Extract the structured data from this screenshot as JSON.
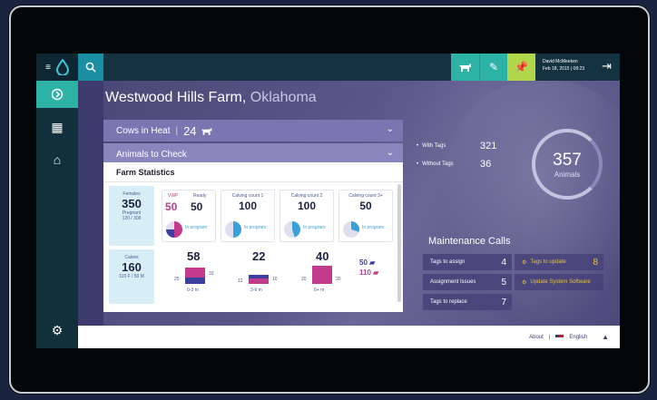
{
  "header": {
    "user_name": "David McMeeken",
    "user_date": "Feb 18, 2015 | 08:23",
    "actions": [
      "cow-icon",
      "pencil-icon",
      "pin-icon"
    ],
    "colors": {
      "cow": "#2cb3a6",
      "pencil": "#2cb3a6",
      "pin": "#b2d64a"
    }
  },
  "farm": {
    "name": "Westwood Hills Farm,",
    "state": "Oklahoma"
  },
  "dropdowns": {
    "cows_in_heat": "Cows in Heat",
    "cows_in_heat_count": "24",
    "animals_to_check": "Animals to Check"
  },
  "stats": {
    "title": "Farm Statistics",
    "females": {
      "label": "Females",
      "value": "350",
      "sub": "Pregnant",
      "sub_value": "120 / 300"
    },
    "cards": [
      {
        "label1": "VWP",
        "v1": "50",
        "label2": "Ready",
        "v2": "50",
        "note": "In program"
      },
      {
        "label": "Calving count 1",
        "value": "100",
        "note": "In program"
      },
      {
        "label": "Calving count 2",
        "value": "100",
        "note": "In program"
      },
      {
        "label": "Calving count 3+",
        "value": "50",
        "note": "In program"
      }
    ],
    "calves": {
      "label": "Calves",
      "value": "160",
      "sub": "110 F / 50 M"
    },
    "calf_groups": [
      {
        "value": "58",
        "left": "25",
        "right": "33",
        "range": "0-3 m"
      },
      {
        "value": "22",
        "left": "12",
        "right": "10",
        "range": "3-6 m"
      },
      {
        "value": "40",
        "left": "20",
        "right": "20",
        "range": "6+ m"
      }
    ],
    "male_count": "50",
    "female_count": "110"
  },
  "tags": {
    "with_label": "With Tags",
    "with_value": "321",
    "without_label": "Without Tags",
    "without_value": "36"
  },
  "animals": {
    "count": "357",
    "label": "Animals"
  },
  "maintenance": {
    "title": "Maintenance Calls",
    "rows": [
      {
        "label": "Tags to assign",
        "value": "4"
      },
      {
        "label": "Assignment Issues",
        "value": "5"
      },
      {
        "label": "Tags to replace",
        "value": "7"
      }
    ],
    "updates": {
      "label": "Tags to update",
      "value": "8",
      "system": "Update System Software"
    }
  },
  "footer": {
    "about": "About",
    "language": "English"
  }
}
